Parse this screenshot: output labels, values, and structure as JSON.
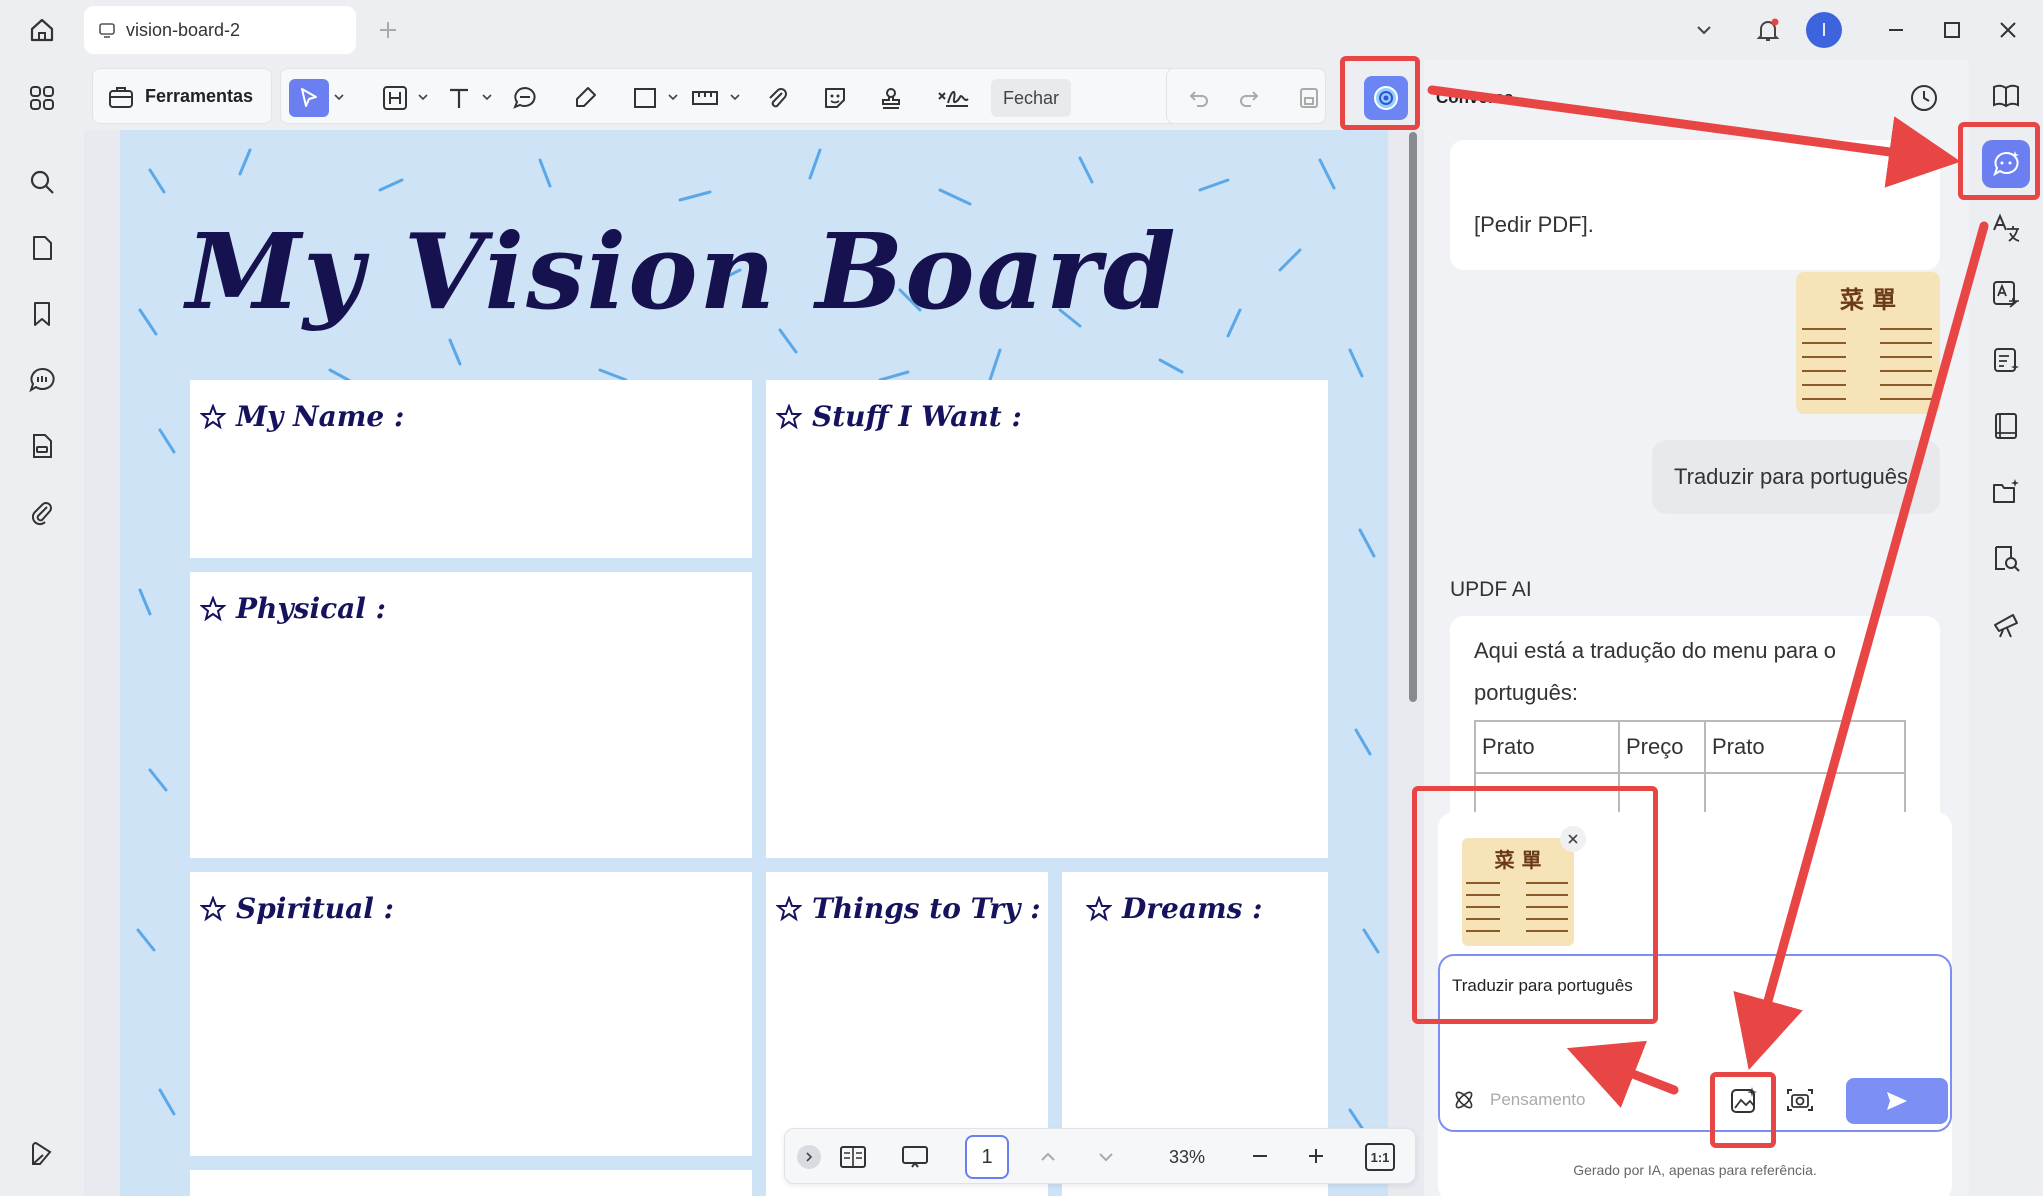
{
  "window": {
    "tab_title": "vision-board-2",
    "avatar_letter": "I"
  },
  "toolbar": {
    "tools_label": "Ferramentas",
    "close_label": "Fechar"
  },
  "document": {
    "title": "My Vision Board",
    "cards": [
      {
        "label": "My Name :"
      },
      {
        "label": "Stuff I Want :"
      },
      {
        "label": "Physical :"
      },
      {
        "label": "Spiritual :"
      },
      {
        "label": "Things to Try :"
      },
      {
        "label": "Dreams :"
      }
    ]
  },
  "pagenav": {
    "page_number": "1",
    "zoom": "33%",
    "fit_label": "1:1"
  },
  "chat": {
    "header": "Conversa",
    "prev_message_tail": "[Pedir PDF].",
    "user_message": "Traduzir para português",
    "ai_name": "UPDF AI",
    "ai_message": "Aqui está a tradução do menu para o português:",
    "ai_table_header": [
      "Prato",
      "Preço",
      "Prato"
    ],
    "menu_thumb_title": "菜 單",
    "input_text": "Traduzir para português",
    "thinking_placeholder": "Pensamento",
    "disclaimer": "Gerado por IA, apenas para referência."
  },
  "colors": {
    "accent": "#6b7ff0",
    "annotation_red": "#e84545",
    "page_bg": "#cfe3f7",
    "title_navy": "#15124f"
  }
}
